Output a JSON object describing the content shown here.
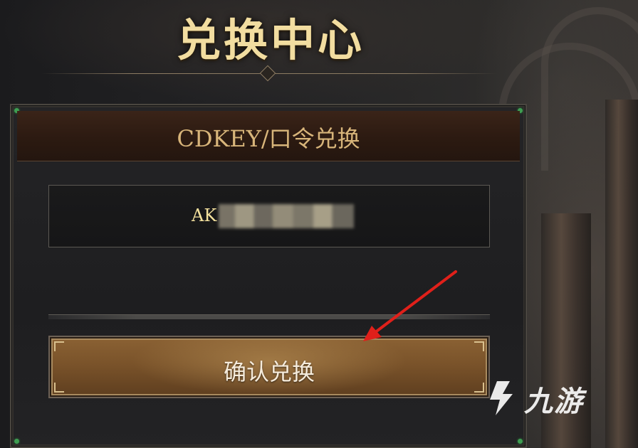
{
  "page_title": "兑换中心",
  "panel": {
    "header": "CDKEY/口令兑换",
    "code_value": "AK"
  },
  "confirm_button": {
    "label": "确认兑换"
  },
  "watermark": {
    "text": "九游"
  },
  "colors": {
    "title": "#f2dda0",
    "header_text": "#d8b57a",
    "code_text": "#f5e29e",
    "button_gold": "#7a532a",
    "annotation_arrow": "#e0201a",
    "gem_green": "#3f9e52"
  }
}
